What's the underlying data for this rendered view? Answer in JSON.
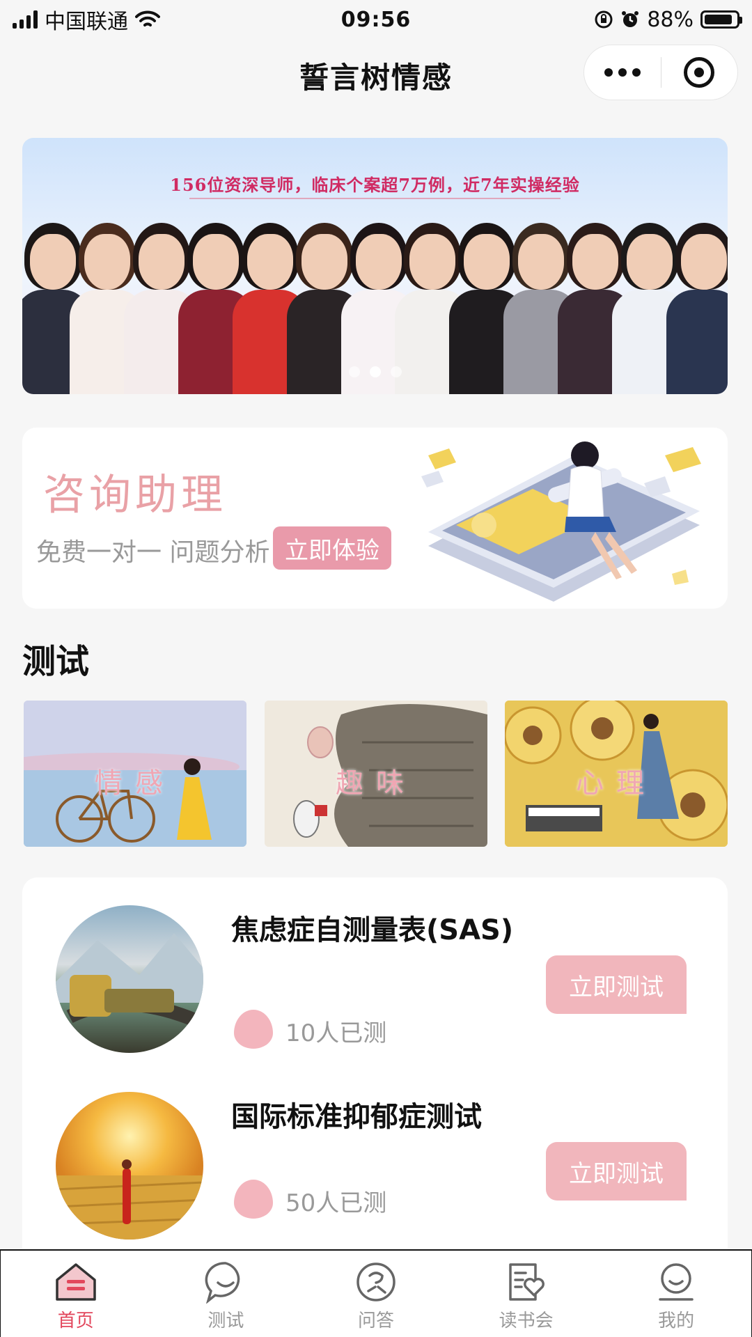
{
  "status_bar": {
    "carrier": "中国联通",
    "time": "09:56",
    "battery": "88%",
    "battery_level": 0.88
  },
  "nav": {
    "title": "誓言树情感",
    "more_icon": "more-dots-icon",
    "close_icon": "target-circle-icon"
  },
  "banner": {
    "headline": "156位资深导师，临床个案超7万例，近7年实操经验",
    "slide_count": 3,
    "active_slide": 2
  },
  "consult": {
    "title": "咨询助理",
    "subtitle": "免费一对一 问题分析",
    "button": "立即体验"
  },
  "section": {
    "title": "测试"
  },
  "categories": [
    {
      "label": "情感"
    },
    {
      "label": "趣味"
    },
    {
      "label": "心理"
    }
  ],
  "tests": [
    {
      "title": "焦虑症自测量表(SAS)",
      "count": "10人已测",
      "button": "立即测试"
    },
    {
      "title": "国际标准抑郁症测试",
      "count": "50人已测",
      "button": "立即测试"
    }
  ],
  "tabbar": {
    "items": [
      {
        "label": "首页",
        "icon": "home-icon",
        "active": true
      },
      {
        "label": "测试",
        "icon": "chat-bubble-icon",
        "active": false
      },
      {
        "label": "问答",
        "icon": "qa-face-icon",
        "active": false
      },
      {
        "label": "读书会",
        "icon": "book-heart-icon",
        "active": false
      },
      {
        "label": "我的",
        "icon": "profile-smile-icon",
        "active": false
      }
    ]
  },
  "colors": {
    "accent": "#e2475c",
    "pink_button": "#f1b6bc",
    "banner_text": "#d02b63"
  }
}
